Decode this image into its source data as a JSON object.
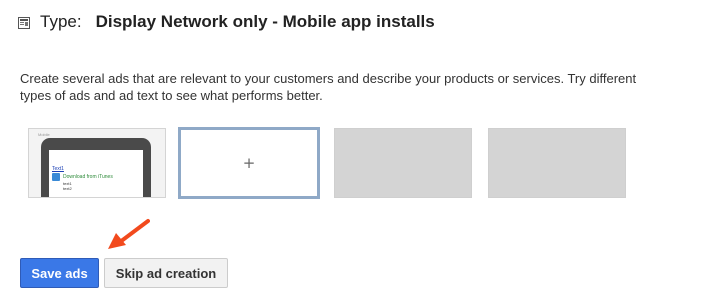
{
  "header": {
    "type_label": "Type:",
    "type_value": "Display Network only - Mobile app installs",
    "collapse_icon": "collapse-icon"
  },
  "description": "Create several ads that are relevant to your customers and describe your products or services. Try different types of ads and ad text to see what performs better.",
  "tiles": {
    "add_tile_symbol": "+",
    "preview": {
      "caption": "Mobile",
      "headline": "Text1",
      "cta": "Download from iTunes",
      "line1": "text1",
      "line2": "text2"
    }
  },
  "actions": {
    "save_label": "Save ads",
    "skip_label": "Skip ad creation"
  },
  "colors": {
    "primary_button": "#3a78e7",
    "arrow": "#f24a1d",
    "selected_tile_border": "#8fa9c7"
  }
}
